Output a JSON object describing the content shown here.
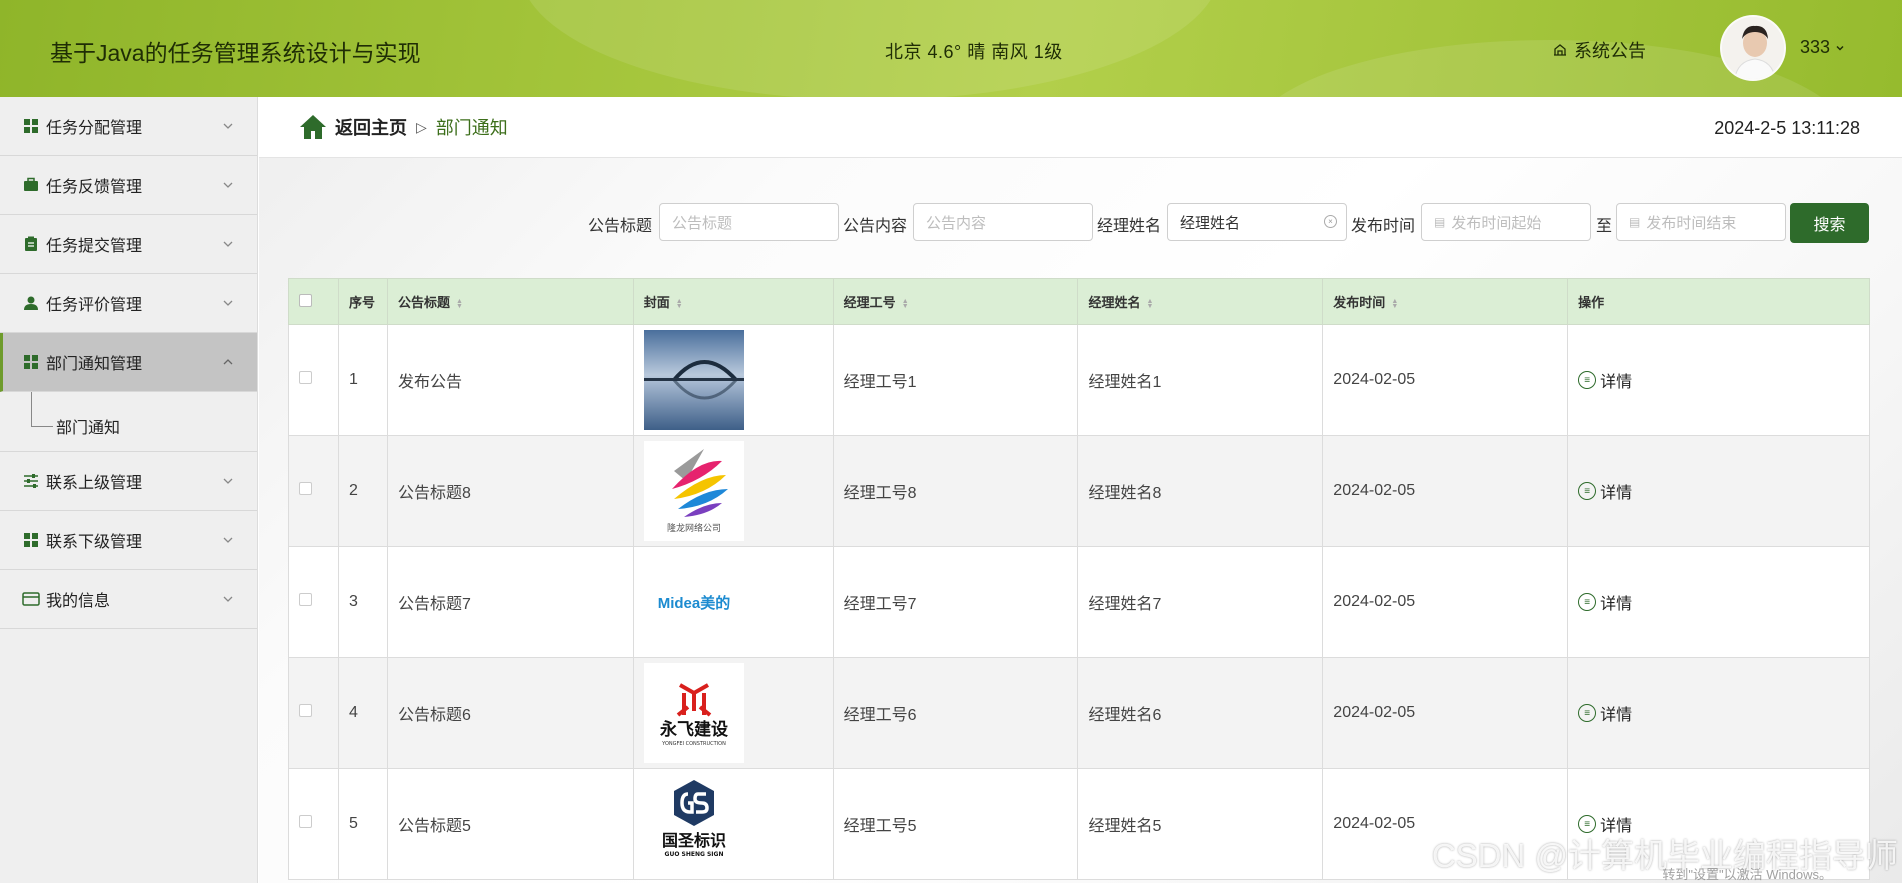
{
  "header": {
    "title": "基于Java的任务管理系统设计与实现",
    "weather": "北京  4.6°  晴  南风  1级",
    "notice_label": "系统公告",
    "username": "333"
  },
  "sidebar": {
    "items": [
      {
        "label": "任务分配管理"
      },
      {
        "label": "任务反馈管理"
      },
      {
        "label": "任务提交管理"
      },
      {
        "label": "任务评价管理"
      },
      {
        "label": "部门通知管理"
      },
      {
        "label": "联系上级管理"
      },
      {
        "label": "联系下级管理"
      },
      {
        "label": "我的信息"
      }
    ],
    "submenu_label": "部门通知"
  },
  "breadcrumb": {
    "home": "返回主页",
    "current": "部门通知"
  },
  "datetime": "2024-2-5 13:11:28",
  "search": {
    "title_label": "公告标题",
    "title_placeholder": "公告标题",
    "content_label": "公告内容",
    "content_placeholder": "公告内容",
    "manager_label": "经理姓名",
    "manager_value": "经理姓名",
    "time_label": "发布时间",
    "start_placeholder": "发布时间起始",
    "to_label": "至",
    "end_placeholder": "发布时间结束",
    "button": "搜索"
  },
  "table": {
    "headers": [
      "序号",
      "公告标题",
      "封面",
      "经理工号",
      "经理姓名",
      "发布时间",
      "操作"
    ],
    "rows": [
      {
        "no": "1",
        "title": "发布公告",
        "cover": "bridge",
        "manager_id": "经理工号1",
        "manager_name": "经理姓名1",
        "time": "2024-02-05",
        "action": "详情"
      },
      {
        "no": "2",
        "title": "公告标题8",
        "cover": "feather",
        "manager_id": "经理工号8",
        "manager_name": "经理姓名8",
        "time": "2024-02-05",
        "action": "详情"
      },
      {
        "no": "3",
        "title": "公告标题7",
        "cover": "midea",
        "manager_id": "经理工号7",
        "manager_name": "经理姓名7",
        "time": "2024-02-05",
        "action": "详情"
      },
      {
        "no": "4",
        "title": "公告标题6",
        "cover": "yongfei",
        "manager_id": "经理工号6",
        "manager_name": "经理姓名6",
        "time": "2024-02-05",
        "action": "详情"
      },
      {
        "no": "5",
        "title": "公告标题5",
        "cover": "guosheng",
        "manager_id": "经理工号5",
        "manager_name": "经理姓名5",
        "time": "2024-02-05",
        "action": "详情"
      }
    ],
    "logo_text": {
      "feather": "隆龙网络公司",
      "midea": "Midea美的",
      "yongfei_cn": "永飞建设",
      "yongfei_en": "YONGFEI CONSTRUCTION",
      "guosheng_cn": "国圣标识",
      "guosheng_en": "GUO SHENG SIGN"
    }
  },
  "watermark": "CSDN @计算机毕业编程指导师",
  "activate_text": "转到\"设置\"以激活 Windows。",
  "colors": {
    "header_green": "#a3c43a",
    "button_green": "#2e6b2b",
    "table_header": "#dbeed5",
    "sidebar_active": "#c4c4c4"
  }
}
